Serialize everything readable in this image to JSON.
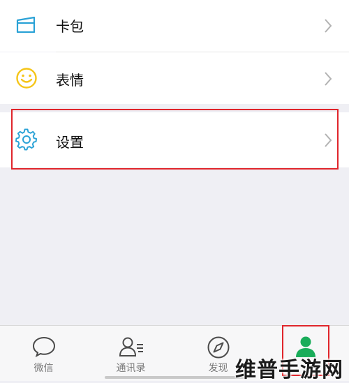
{
  "menu": {
    "items": [
      {
        "label": "卡包",
        "icon": "card-wallet-icon"
      },
      {
        "label": "表情",
        "icon": "smiley-icon"
      },
      {
        "label": "设置",
        "icon": "gear-icon"
      }
    ]
  },
  "tabbar": {
    "tabs": [
      {
        "label": "微信",
        "icon": "chat-bubble-icon"
      },
      {
        "label": "通讯录",
        "icon": "contacts-icon"
      },
      {
        "label": "发现",
        "icon": "compass-icon"
      },
      {
        "label": "",
        "icon": "person-icon",
        "active": true
      }
    ]
  },
  "watermark": "维普手游网",
  "colors": {
    "accent_blue": "#2aa2d6",
    "smiley_yellow": "#f5c518",
    "active_green": "#1aad5a",
    "highlight_red": "#e0252b"
  }
}
